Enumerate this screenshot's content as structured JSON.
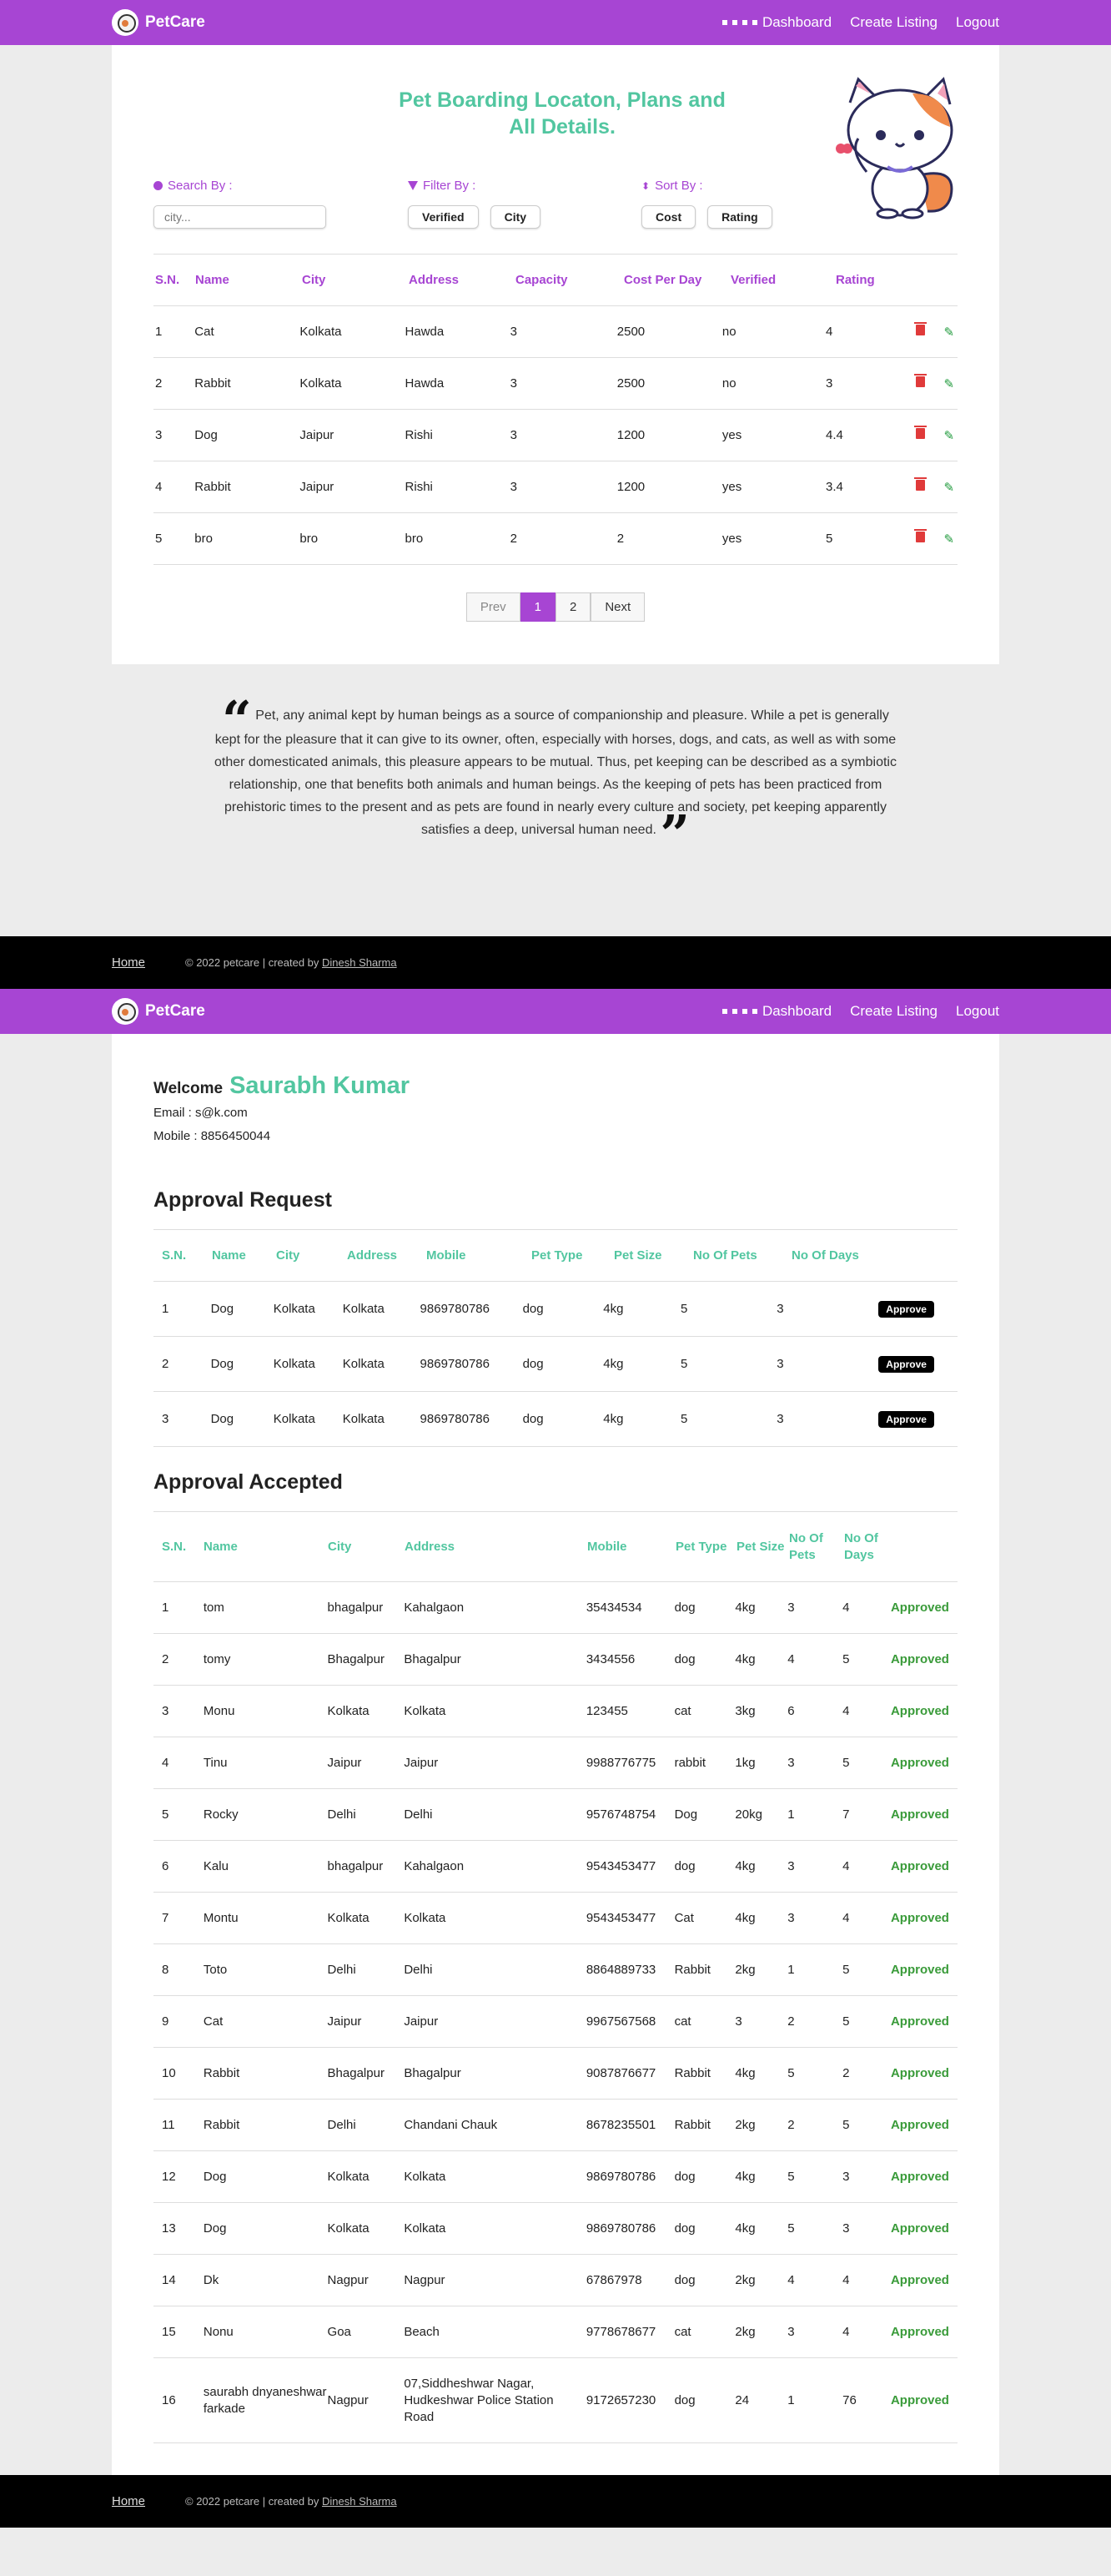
{
  "nav": {
    "brand": "PetCare",
    "dashboard": "Dashboard",
    "create": "Create Listing",
    "logout": "Logout"
  },
  "hero": {
    "title": "Pet Boarding Locaton, Plans and All Details."
  },
  "controls": {
    "search_label": "Search By :",
    "search_placeholder": "city...",
    "filter_label": "Filter By :",
    "filter_options": [
      "Verified",
      "City"
    ],
    "sort_label": "Sort By :",
    "sort_options": [
      "Cost",
      "Rating"
    ]
  },
  "listings": {
    "headers": [
      "S.N.",
      "Name",
      "City",
      "Address",
      "Capacity",
      "Cost Per Day",
      "Verified",
      "Rating"
    ],
    "rows": [
      [
        "1",
        "Cat",
        "Kolkata",
        "Hawda",
        "3",
        "2500",
        "no",
        "4"
      ],
      [
        "2",
        "Rabbit",
        "Kolkata",
        "Hawda",
        "3",
        "2500",
        "no",
        "3"
      ],
      [
        "3",
        "Dog",
        "Jaipur",
        "Rishi",
        "3",
        "1200",
        "yes",
        "4.4"
      ],
      [
        "4",
        "Rabbit",
        "Jaipur",
        "Rishi",
        "3",
        "1200",
        "yes",
        "3.4"
      ],
      [
        "5",
        "bro",
        "bro",
        "bro",
        "2",
        "2",
        "yes",
        "5"
      ]
    ]
  },
  "pager": {
    "prev": "Prev",
    "pages": [
      "1",
      "2"
    ],
    "next": "Next"
  },
  "quote": {
    "text": "Pet, any animal kept by human beings as a source of companionship and pleasure. While a pet is generally kept for the pleasure that it can give to its owner, often, especially with horses, dogs, and cats, as well as with some other domesticated animals, this pleasure appears to be mutual. Thus, pet keeping can be described as a symbiotic relationship, one that benefits both animals and human beings. As the keeping of pets has been practiced from prehistoric times to the present and as pets are found in nearly every culture and society, pet keeping apparently satisfies a deep, universal human need."
  },
  "footer": {
    "home": "Home",
    "copy": "© 2022 petcare | created by ",
    "author": "Dinesh Sharma"
  },
  "profile": {
    "welcome": "Welcome",
    "name": "Saurabh Kumar",
    "email": "Email : s@k.com",
    "mobile": "Mobile : 8856450044"
  },
  "requests": {
    "title": "Approval Request",
    "headers": [
      "S.N.",
      "Name",
      "City",
      "Address",
      "Mobile",
      "Pet Type",
      "Pet Size",
      "No Of Pets",
      "No Of Days"
    ],
    "button": "Approve",
    "rows": [
      [
        "1",
        "Dog",
        "Kolkata",
        "Kolkata",
        "9869780786",
        "dog",
        "4kg",
        "5",
        "3"
      ],
      [
        "2",
        "Dog",
        "Kolkata",
        "Kolkata",
        "9869780786",
        "dog",
        "4kg",
        "5",
        "3"
      ],
      [
        "3",
        "Dog",
        "Kolkata",
        "Kolkata",
        "9869780786",
        "dog",
        "4kg",
        "5",
        "3"
      ]
    ]
  },
  "accepted": {
    "title": "Approval Accepted",
    "headers": [
      "S.N.",
      "Name",
      "City",
      "Address",
      "Mobile",
      "Pet Type",
      "Pet Size",
      "No Of Pets",
      "No Of Days"
    ],
    "status": "Approved",
    "rows": [
      [
        "1",
        "tom",
        "bhagalpur",
        "Kahalgaon",
        "35434534",
        "dog",
        "4kg",
        "3",
        "4"
      ],
      [
        "2",
        "tomy",
        "Bhagalpur",
        "Bhagalpur",
        "3434556",
        "dog",
        "4kg",
        "4",
        "5"
      ],
      [
        "3",
        "Monu",
        "Kolkata",
        "Kolkata",
        "123455",
        "cat",
        "3kg",
        "6",
        "4"
      ],
      [
        "4",
        "Tinu",
        "Jaipur",
        "Jaipur",
        "9988776775",
        "rabbit",
        "1kg",
        "3",
        "5"
      ],
      [
        "5",
        "Rocky",
        "Delhi",
        "Delhi",
        "9576748754",
        "Dog",
        "20kg",
        "1",
        "7"
      ],
      [
        "6",
        "Kalu",
        "bhagalpur",
        "Kahalgaon",
        "9543453477",
        "dog",
        "4kg",
        "3",
        "4"
      ],
      [
        "7",
        "Montu",
        "Kolkata",
        "Kolkata",
        "9543453477",
        "Cat",
        "4kg",
        "3",
        "4"
      ],
      [
        "8",
        "Toto",
        "Delhi",
        "Delhi",
        "8864889733",
        "Rabbit",
        "2kg",
        "1",
        "5"
      ],
      [
        "9",
        "Cat",
        "Jaipur",
        "Jaipur",
        "9967567568",
        "cat",
        "3",
        "2",
        "5"
      ],
      [
        "10",
        "Rabbit",
        "Bhagalpur",
        "Bhagalpur",
        "9087876677",
        "Rabbit",
        "4kg",
        "5",
        "2"
      ],
      [
        "11",
        "Rabbit",
        "Delhi",
        "Chandani Chauk",
        "8678235501",
        "Rabbit",
        "2kg",
        "2",
        "5"
      ],
      [
        "12",
        "Dog",
        "Kolkata",
        "Kolkata",
        "9869780786",
        "dog",
        "4kg",
        "5",
        "3"
      ],
      [
        "13",
        "Dog",
        "Kolkata",
        "Kolkata",
        "9869780786",
        "dog",
        "4kg",
        "5",
        "3"
      ],
      [
        "14",
        "Dk",
        "Nagpur",
        "Nagpur",
        "67867978",
        "dog",
        "2kg",
        "4",
        "4"
      ],
      [
        "15",
        "Nonu",
        "Goa",
        "Beach",
        "9778678677",
        "cat",
        "2kg",
        "3",
        "4"
      ],
      [
        "16",
        "saurabh dnyaneshwar farkade",
        "Nagpur",
        "07,Siddheshwar Nagar, Hudkeshwar Police Station Road",
        "9172657230",
        "dog",
        "24",
        "1",
        "76"
      ]
    ]
  },
  "colors": {
    "purple": "#a745d3",
    "teal": "#52c6a0",
    "green": "#3a9b3a",
    "red": "#e03a3a"
  }
}
